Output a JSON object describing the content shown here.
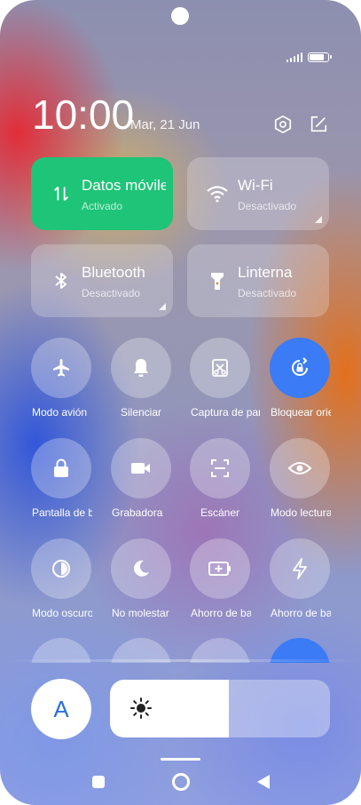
{
  "status": {
    "battery_level": 0.8
  },
  "header": {
    "time": "10:00",
    "date": "Mar, 21 Jun",
    "icons": [
      "settings-hex-icon",
      "edit-icon"
    ]
  },
  "tiles": [
    {
      "name": "Datos móviles",
      "state": "Activado",
      "icon": "mobile-data-icon",
      "active": true
    },
    {
      "name": "Wi-Fi",
      "state": "Desactivado",
      "icon": "wifi-icon",
      "active": false
    },
    {
      "name": "Bluetooth",
      "state": "Desactivado",
      "icon": "bluetooth-icon",
      "active": false
    },
    {
      "name": "Linterna",
      "state": "Desactivado",
      "icon": "flashlight-icon",
      "active": false
    }
  ],
  "toggles": [
    {
      "label": "Modo avión",
      "icon": "airplane-icon",
      "active": false
    },
    {
      "label": "Silenciar",
      "icon": "bell-icon",
      "active": false
    },
    {
      "label": "Captura de pantalla",
      "icon": "screenshot-icon",
      "active": false
    },
    {
      "label": "Bloquear orientación",
      "icon": "rotation-lock-icon",
      "active": true
    },
    {
      "label": "Pantalla de bloqueo",
      "icon": "lock-icon",
      "active": false
    },
    {
      "label": "Grabadora",
      "icon": "video-camera-icon",
      "active": false
    },
    {
      "label": "Escáner",
      "icon": "scanner-icon",
      "active": false
    },
    {
      "label": "Modo lectura",
      "icon": "eye-icon",
      "active": false
    },
    {
      "label": "Modo oscuro",
      "icon": "dark-mode-icon",
      "active": false
    },
    {
      "label": "No molestar",
      "icon": "moon-icon",
      "active": false
    },
    {
      "label": "Ahorro de batería",
      "icon": "battery-saver-icon",
      "active": false
    },
    {
      "label": "Ahorro de batería extremo",
      "icon": "lightning-icon",
      "active": false
    }
  ],
  "brightness": {
    "auto_label": "A",
    "level": 0.54
  },
  "colors": {
    "active_green": "#1ec477",
    "active_blue": "#3b7bf6",
    "auto_text": "#2a6fe0"
  },
  "nav": [
    "recents-square-icon",
    "home-circle-icon",
    "back-triangle-icon"
  ]
}
